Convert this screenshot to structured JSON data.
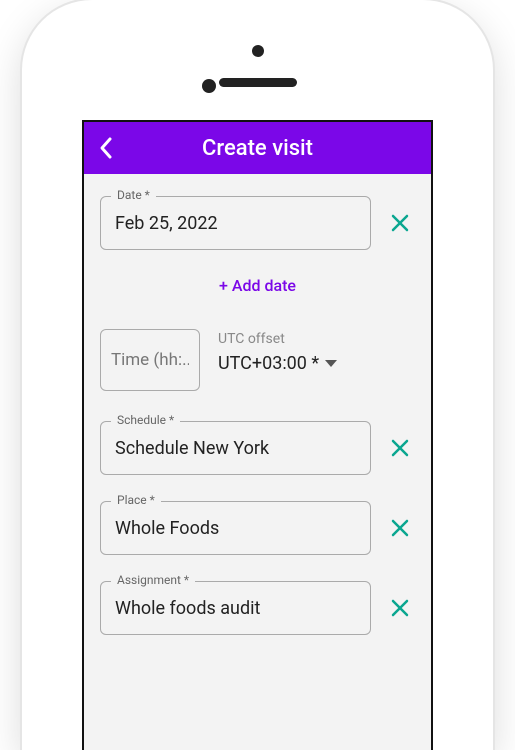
{
  "header": {
    "title": "Create visit"
  },
  "date": {
    "label": "Date *",
    "value": "Feb 25, 2022"
  },
  "add_date_label": "+ Add date",
  "time": {
    "placeholder": "Time (hh:..",
    "utc_label": "UTC offset",
    "utc_value": "UTC+03:00 *"
  },
  "schedule": {
    "label": "Schedule *",
    "value": "Schedule New York"
  },
  "place": {
    "label": "Place *",
    "value": "Whole Foods"
  },
  "assignment": {
    "label": "Assignment *",
    "value": "Whole foods audit"
  },
  "colors": {
    "accent": "#7b07e8",
    "teal": "#0aa690"
  }
}
